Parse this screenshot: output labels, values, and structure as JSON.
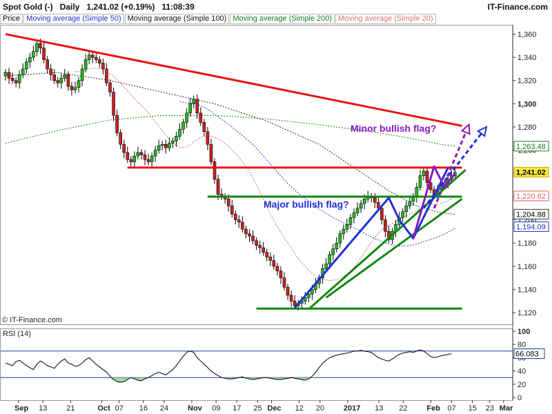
{
  "header": {
    "title": "Spot Gold (-)   Daily   1,241.02 (+0.19%)   11:08:39",
    "brand": "IT-Finance.com"
  },
  "legend": [
    {
      "label": "Price",
      "color": "#000000"
    },
    {
      "label": "Moving average (Simple 50)",
      "color": "#1f35c8"
    },
    {
      "label": "Moving average (Simple 100)",
      "color": "#111111"
    },
    {
      "label": "Moving average (Simple 200)",
      "color": "#1a7a1a"
    },
    {
      "label": "Moving average (Simple 20)",
      "color": "#e07070"
    }
  ],
  "watermark": "© IT-Finance.com",
  "colors": {
    "up_candle": "#22bb22",
    "down_candle": "#cc2222",
    "ma50": "#2233cc",
    "ma100": "#222222",
    "ma200": "#1a7a1a",
    "ma20": "#e06060",
    "trend_red": "#ee1111",
    "trend_green": "#118811",
    "flag_blue": "#1f2fd8",
    "flag_purple": "#8a17c0",
    "rsi_line": "#000000",
    "rsi_fill": "#8fd18f"
  },
  "chart_data": [
    {
      "type": "candlestick",
      "title": "Spot Gold (-) Daily",
      "ylim": [
        1110,
        1368
      ],
      "yticks": [
        1120,
        1140,
        1160,
        1180,
        1200,
        1220,
        1240,
        1260,
        1280,
        1300,
        1320,
        1340,
        1360
      ],
      "ytick_labels": [
        "1,120",
        "1,140",
        "1,160",
        "1,180",
        "1,200",
        "1,220",
        "1,240",
        "1,260",
        "1,280",
        "1,300",
        "1,320",
        "1,340",
        "1,360"
      ],
      "xticks": [
        "Sep",
        "13",
        "21",
        "Oct",
        "07",
        "16",
        "24",
        "Nov",
        "09",
        "17",
        "25",
        "Dec",
        "12",
        "20",
        "2017",
        "13",
        "22",
        "Feb",
        "07",
        "15",
        "23",
        "Mar"
      ],
      "bold_xticks": [
        "Sep",
        "Oct",
        "Nov",
        "Dec",
        "2017",
        "Feb",
        "Mar"
      ],
      "annotations": [
        "Minor bullish flag?",
        "Major bullish flag?"
      ],
      "price_badges": [
        {
          "label": "1,263.48",
          "value": 1263.48,
          "series": "MA 200"
        },
        {
          "label": "1,241.02",
          "value": 1241.02,
          "series": "Price"
        },
        {
          "label": "1,220.62",
          "value": 1220.62,
          "series": "MA 20"
        },
        {
          "label": "1,204.88",
          "value": 1204.88,
          "series": "MA 100"
        },
        {
          "label": "1,194.09",
          "value": 1194.09,
          "series": "MA 50"
        }
      ],
      "close": [
        1327,
        1322,
        1320,
        1318,
        1325,
        1330,
        1336,
        1340,
        1345,
        1352,
        1348,
        1338,
        1330,
        1325,
        1320,
        1318,
        1322,
        1325,
        1315,
        1312,
        1314,
        1320,
        1330,
        1338,
        1342,
        1340,
        1338,
        1335,
        1330,
        1318,
        1310,
        1290,
        1275,
        1265,
        1258,
        1252,
        1250,
        1255,
        1258,
        1256,
        1252,
        1250,
        1255,
        1260,
        1264,
        1265,
        1262,
        1266,
        1268,
        1272,
        1278,
        1284,
        1292,
        1300,
        1304,
        1292,
        1284,
        1276,
        1265,
        1250,
        1235,
        1222,
        1220,
        1218,
        1212,
        1205,
        1200,
        1198,
        1192,
        1188,
        1186,
        1182,
        1178,
        1176,
        1172,
        1168,
        1165,
        1160,
        1156,
        1150,
        1142,
        1135,
        1130,
        1126,
        1128,
        1130,
        1133,
        1136,
        1140,
        1145,
        1150,
        1158,
        1162,
        1170,
        1175,
        1180,
        1188,
        1192,
        1196,
        1202,
        1206,
        1210,
        1214,
        1218,
        1220,
        1219,
        1215,
        1210,
        1200,
        1190,
        1183,
        1190,
        1196,
        1202,
        1207,
        1212,
        1216,
        1220,
        1228,
        1238,
        1242,
        1232,
        1226,
        1222,
        1226,
        1230,
        1232,
        1235,
        1238,
        1241
      ],
      "ma20_start_index": 20,
      "ma50_start_index": 50,
      "ma100": [
        [
          0,
          1324
        ],
        [
          15,
          1327
        ],
        [
          30,
          1320
        ],
        [
          45,
          1310
        ],
        [
          60,
          1300
        ],
        [
          75,
          1285
        ],
        [
          90,
          1265
        ],
        [
          100,
          1245
        ],
        [
          110,
          1225
        ],
        [
          118,
          1212
        ],
        [
          125,
          1206
        ],
        [
          129,
          1204.88
        ]
      ],
      "ma200": [
        [
          0,
          1266
        ],
        [
          15,
          1277
        ],
        [
          30,
          1286
        ],
        [
          45,
          1290
        ],
        [
          60,
          1290
        ],
        [
          75,
          1287
        ],
        [
          90,
          1282
        ],
        [
          105,
          1276
        ],
        [
          115,
          1271
        ],
        [
          125,
          1265
        ],
        [
          129,
          1263.48
        ]
      ],
      "trendlines": [
        {
          "name": "red-descending-resistance",
          "color": "red",
          "from": [
            0,
            1360
          ],
          "to": [
            131,
            1281
          ]
        },
        {
          "name": "red-horizontal-resistance",
          "color": "red",
          "from": [
            35,
            1245
          ],
          "to": [
            131,
            1245
          ]
        },
        {
          "name": "green-horizontal-neckline",
          "color": "green",
          "from": [
            58,
            1220
          ],
          "to": [
            131,
            1220
          ]
        },
        {
          "name": "green-horizontal-support",
          "color": "green",
          "from": [
            72,
            1123.5
          ],
          "to": [
            131,
            1123.5
          ]
        },
        {
          "name": "green-rising-support",
          "color": "green",
          "from": [
            87,
            1123
          ],
          "to": [
            132,
            1243
          ]
        },
        {
          "name": "green-rising-support-lower",
          "color": "green",
          "from": [
            92,
            1133
          ],
          "to": [
            131,
            1218
          ]
        }
      ],
      "flags": [
        {
          "name": "major-flagpole",
          "color": "blue",
          "points": [
            [
              83,
              1124
            ],
            [
              110,
              1219
            ],
            [
              113,
              1200
            ],
            [
              117,
              1184
            ],
            [
              127,
              1245
            ]
          ]
        },
        {
          "name": "minor-flag-pole",
          "color": "purple",
          "points": [
            [
              117,
              1184
            ],
            [
              123,
              1246
            ],
            [
              126,
              1228
            ],
            [
              129,
              1240
            ]
          ]
        },
        {
          "name": "blue-target-arrow",
          "color": "blue",
          "dashed": true,
          "from": [
            120,
            1210
          ],
          "to": [
            138,
            1280
          ]
        },
        {
          "name": "purple-target-arrow",
          "color": "purple",
          "dashed": true,
          "from": [
            123,
            1210
          ],
          "to": [
            133,
            1282
          ]
        }
      ]
    },
    {
      "type": "line",
      "title": "RSI (14)",
      "ylim": [
        0,
        100
      ],
      "yticks": [
        0,
        20,
        40,
        60,
        80,
        100
      ],
      "ytick_labels": [
        "0",
        "20",
        "40",
        "60",
        "80",
        "100"
      ],
      "overbought": 70,
      "oversold": 30,
      "last_value_label": "66.083",
      "last_value": 66.083,
      "values": [
        52,
        50,
        48,
        54,
        56,
        52,
        48,
        45,
        42,
        50,
        55,
        52,
        48,
        46,
        44,
        50,
        55,
        58,
        52,
        50,
        47,
        48,
        52,
        57,
        60,
        55,
        50,
        46,
        42,
        38,
        32,
        27,
        24,
        23,
        24,
        27,
        30,
        28,
        26,
        25,
        28,
        30,
        33,
        36,
        38,
        36,
        34,
        38,
        42,
        48,
        55,
        62,
        68,
        70,
        68,
        60,
        55,
        50,
        45,
        40,
        36,
        33,
        30,
        29,
        28,
        28,
        29,
        30,
        31,
        29,
        28,
        27,
        28,
        29,
        30,
        30,
        29,
        28,
        27,
        27,
        28,
        29,
        30,
        29,
        28,
        27,
        26,
        28,
        32,
        38,
        45,
        52,
        56,
        60,
        62,
        64,
        65,
        66,
        67,
        68,
        70,
        70,
        71,
        70,
        69,
        68,
        64,
        60,
        58,
        56,
        55,
        58,
        62,
        65,
        67,
        68,
        69,
        68,
        70,
        72,
        70,
        66,
        62,
        60,
        61,
        63,
        64,
        65,
        66.083
      ]
    }
  ]
}
